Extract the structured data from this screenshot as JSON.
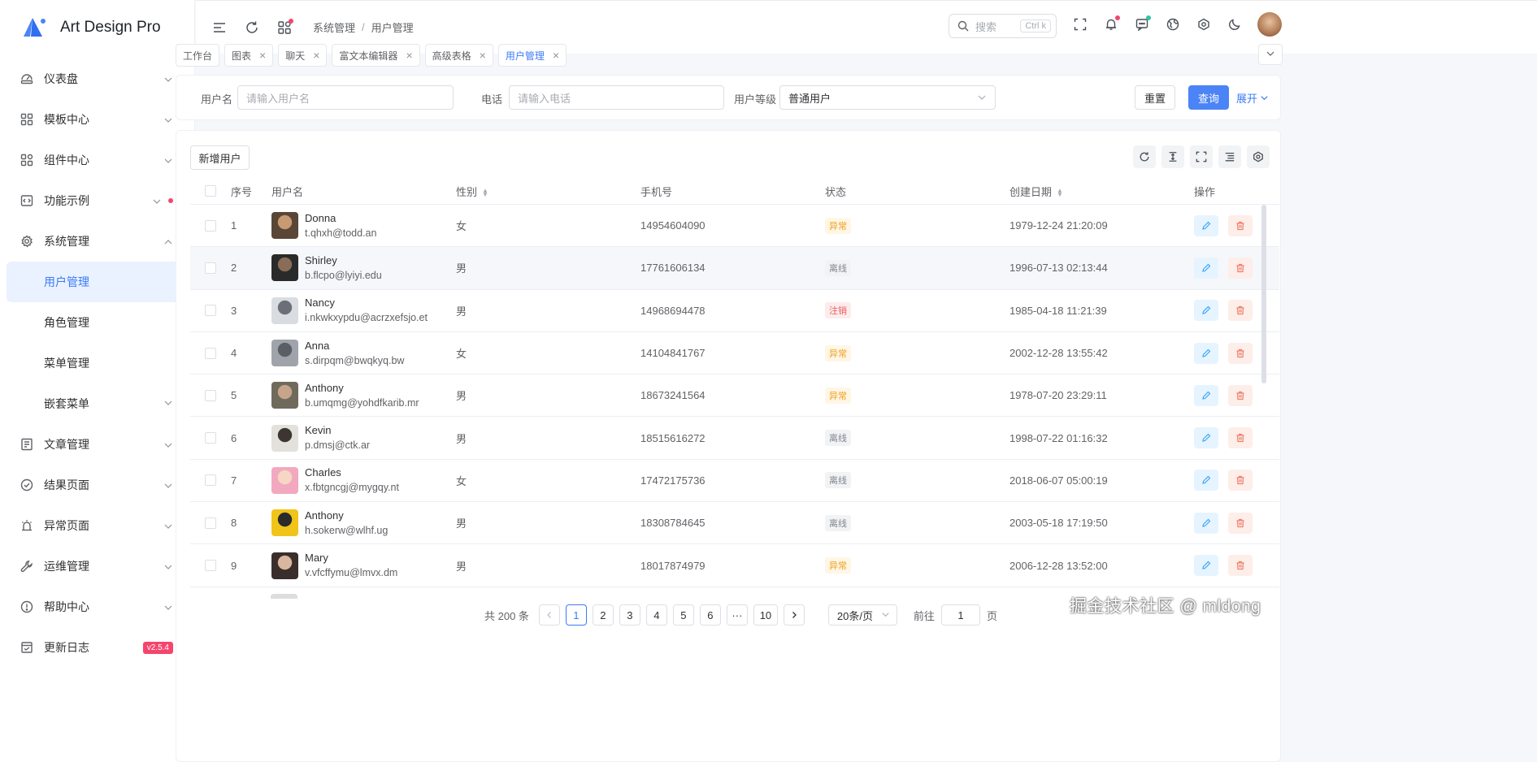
{
  "brand": {
    "name": "Art Design Pro"
  },
  "sidebar": {
    "items": [
      {
        "label": "仪表盘",
        "icon": "dashboard-icon"
      },
      {
        "label": "模板中心",
        "icon": "template-icon"
      },
      {
        "label": "组件中心",
        "icon": "component-icon"
      },
      {
        "label": "功能示例",
        "icon": "code-icon"
      },
      {
        "label": "系统管理",
        "icon": "gear-icon"
      }
    ],
    "system_children": [
      "用户管理",
      "角色管理",
      "菜单管理",
      "嵌套菜单"
    ],
    "items_after": [
      {
        "label": "文章管理",
        "icon": "article-icon"
      },
      {
        "label": "结果页面",
        "icon": "check-circle-icon"
      },
      {
        "label": "异常页面",
        "icon": "alarm-icon"
      },
      {
        "label": "运维管理",
        "icon": "wrench-icon"
      },
      {
        "label": "帮助中心",
        "icon": "help-icon"
      },
      {
        "label": "更新日志",
        "icon": "changelog-icon"
      }
    ],
    "version": "v2.5.4"
  },
  "topbar": {
    "breadcrumb": [
      "系统管理",
      "用户管理"
    ],
    "search_placeholder": "搜索",
    "search_shortcut": "Ctrl k"
  },
  "tabs": [
    "工作台",
    "图表",
    "聊天",
    "富文本编辑器",
    "高级表格",
    "用户管理"
  ],
  "search_form": {
    "username_label": "用户名",
    "username_placeholder": "请输入用户名",
    "phone_label": "电话",
    "phone_placeholder": "请输入电话",
    "level_label": "用户等级",
    "level_value": "普通用户",
    "reset": "重置",
    "query": "查询",
    "expand": "展开"
  },
  "table": {
    "add_button": "新增用户",
    "headers": {
      "no": "序号",
      "user": "用户名",
      "sex": "性别",
      "phone": "手机号",
      "status": "状态",
      "created": "创建日期",
      "ops": "操作"
    },
    "rows": [
      {
        "no": "1",
        "name": "Donna",
        "email": "t.qhxh@todd.an",
        "sex": "女",
        "phone": "14954604090",
        "status": "异常",
        "created": "1979-12-24 21:20:09"
      },
      {
        "no": "2",
        "name": "Shirley",
        "email": "b.flcpo@lyiyi.edu",
        "sex": "男",
        "phone": "17761606134",
        "status": "离线",
        "created": "1996-07-13 02:13:44"
      },
      {
        "no": "3",
        "name": "Nancy",
        "email": "i.nkwkxypdu@acrzxefsjo.et",
        "sex": "男",
        "phone": "14968694478",
        "status": "注销",
        "created": "1985-04-18 11:21:39"
      },
      {
        "no": "4",
        "name": "Anna",
        "email": "s.dirpqm@bwqkyq.bw",
        "sex": "女",
        "phone": "14104841767",
        "status": "异常",
        "created": "2002-12-28 13:55:42"
      },
      {
        "no": "5",
        "name": "Anthony",
        "email": "b.umqmg@yohdfkarib.mr",
        "sex": "男",
        "phone": "18673241564",
        "status": "异常",
        "created": "1978-07-20 23:29:11"
      },
      {
        "no": "6",
        "name": "Kevin",
        "email": "p.dmsj@ctk.ar",
        "sex": "男",
        "phone": "18515616272",
        "status": "离线",
        "created": "1998-07-22 01:16:32"
      },
      {
        "no": "7",
        "name": "Charles",
        "email": "x.fbtgncgj@mygqy.nt",
        "sex": "女",
        "phone": "17472175736",
        "status": "离线",
        "created": "2018-06-07 05:00:19"
      },
      {
        "no": "8",
        "name": "Anthony",
        "email": "h.sokerw@wlhf.ug",
        "sex": "男",
        "phone": "18308784645",
        "status": "离线",
        "created": "2003-05-18 17:19:50"
      },
      {
        "no": "9",
        "name": "Mary",
        "email": "v.vfcffymu@lmvx.dm",
        "sex": "男",
        "phone": "18017874979",
        "status": "异常",
        "created": "2006-12-28 13:52:00"
      }
    ]
  },
  "status_colors": {
    "异常": {
      "bg": "#fff6e5",
      "fg": "#f0a020"
    },
    "离线": {
      "bg": "#f2f3f5",
      "fg": "#808590"
    },
    "注销": {
      "bg": "#fdecec",
      "fg": "#ef5b5b"
    }
  },
  "pagination": {
    "total": "共 200 条",
    "pages": [
      "1",
      "2",
      "3",
      "4",
      "5",
      "6",
      "···",
      "10"
    ],
    "page_size": "20条/页",
    "goto_prefix": "前往",
    "goto_value": "1",
    "goto_suffix": "页"
  },
  "watermark": "掘金技术社区 @ mldong"
}
